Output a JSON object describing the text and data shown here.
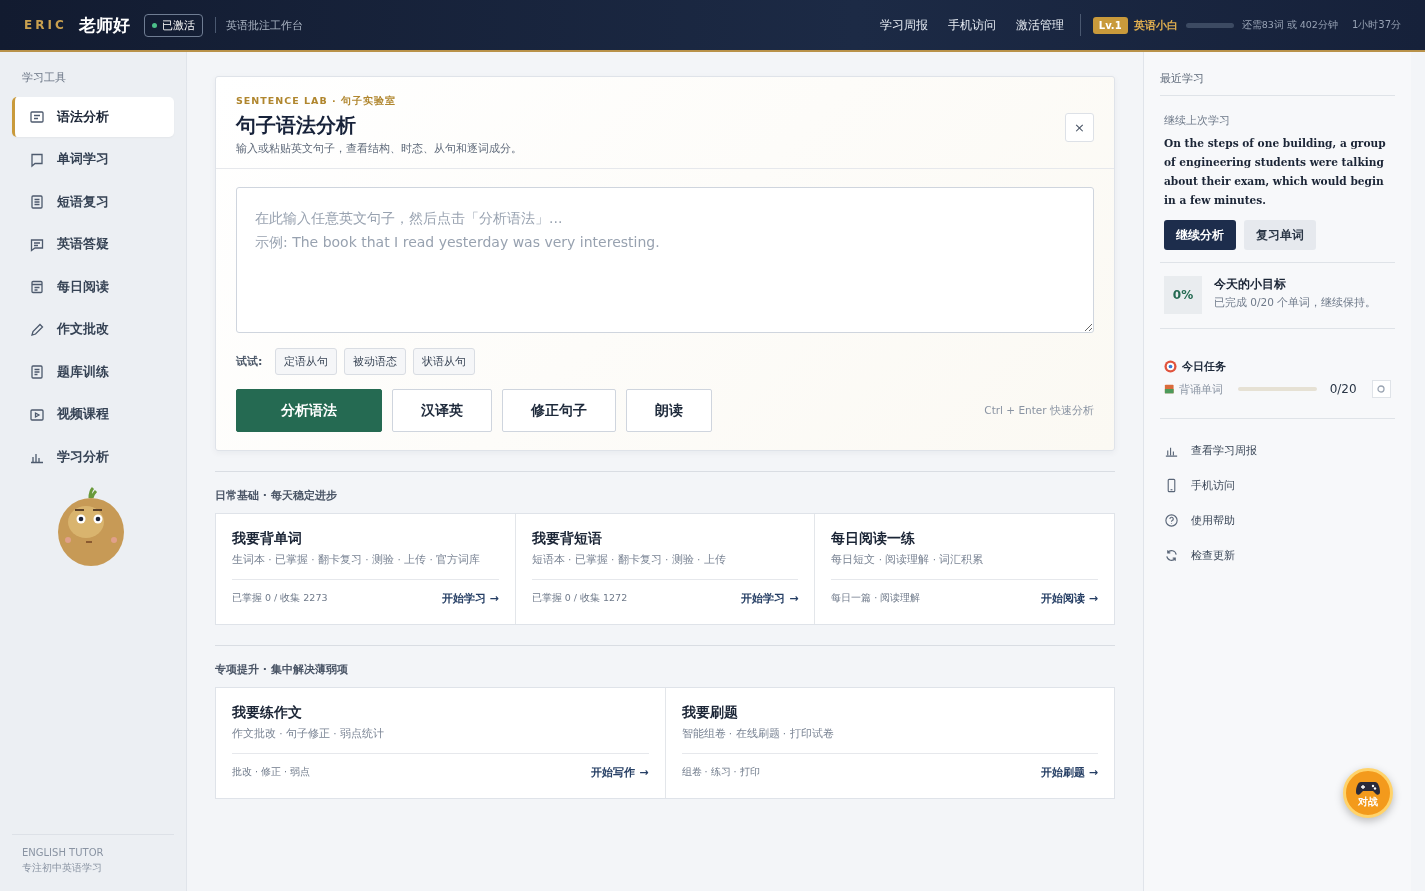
{
  "topbar": {
    "brand": "ERIC",
    "greeting": "老师好",
    "status": {
      "label": "已激活",
      "on": true
    },
    "subtitle": "英语批注工作台",
    "links": [
      "学习周报",
      "手机访问",
      "激活管理"
    ],
    "level": {
      "badge": "Lv.1",
      "title": "英语小白",
      "level": 0.0,
      "remaining": "还需83词 或 402分钟",
      "time": "1小时37分"
    }
  },
  "sidebar": {
    "heading": "学习工具",
    "items": [
      {
        "label": "语法分析",
        "selected": true
      },
      {
        "label": "单词学习",
        "selected": false
      },
      {
        "label": "短语复习",
        "selected": false
      },
      {
        "label": "英语答疑",
        "selected": false
      },
      {
        "label": "每日阅读",
        "selected": false
      },
      {
        "label": "作文批改",
        "selected": false
      },
      {
        "label": "题库训练",
        "selected": false
      },
      {
        "label": "视频课程",
        "selected": false
      },
      {
        "label": "学习分析",
        "selected": false
      }
    ],
    "footer": {
      "title": "ENGLISH TUTOR",
      "subtitle": "专注初中英语学习"
    }
  },
  "lab": {
    "eyebrow": "SENTENCE LAB · 句子实验室",
    "title": "句子语法分析",
    "subtitle": "输入或粘贴英文句子，查看结构、时态、从句和逐词成分。",
    "close": "×",
    "input": {
      "placeholder": "在此输入任意英文句子，然后点击「分析语法」...\n示例: The book that I read yesterday was very interesting."
    },
    "try_label": "试试:",
    "examples": [
      "定语从句",
      "被动语态",
      "状语从句"
    ],
    "actions": [
      {
        "label": "分析语法",
        "kind": "primary"
      },
      {
        "label": "汉译英",
        "kind": "secondary"
      },
      {
        "label": "修正句子",
        "kind": "secondary"
      },
      {
        "label": "朗读",
        "kind": "secondary"
      }
    ],
    "hint": "Ctrl + Enter 快速分析"
  },
  "sections": [
    {
      "title": "日常基础 · 每天稳定进步",
      "cards": [
        {
          "title": "我要背单词",
          "desc": "生词本 · 已掌握 · 翻卡复习 · 测验 · 上传 · 官方词库",
          "meta": "已掌握 0 / 收集 2273",
          "action": "开始学习 →"
        },
        {
          "title": "我要背短语",
          "desc": "短语本 · 已掌握 · 翻卡复习 · 测验 · 上传",
          "meta": "已掌握 0 / 收集 1272",
          "action": "开始学习 →"
        },
        {
          "title": "每日阅读一练",
          "desc": "每日短文 · 阅读理解 · 词汇积累",
          "meta": "每日一篇 · 阅读理解",
          "action": "开始阅读 →"
        }
      ]
    },
    {
      "title": "专项提升 · 集中解决薄弱项",
      "cards": [
        {
          "title": "我要练作文",
          "desc": "作文批改 · 句子修正 · 弱点统计",
          "meta": "批改 · 修正 · 弱点",
          "action": "开始写作 →"
        },
        {
          "title": "我要刷题",
          "desc": "智能组卷 · 在线刷题 · 打印试卷",
          "meta": "组卷 · 练习 · 打印",
          "action": "开始刷题 →"
        }
      ]
    }
  ],
  "right": {
    "heading": "最近学习",
    "resume": {
      "label": "继续上次学习",
      "sentence": "On the steps of one building, a group of engineering students were talking about their exam, which would begin in a few minutes.",
      "buttons": [
        {
          "label": "继续分析",
          "kind": "primary"
        },
        {
          "label": "复习单词",
          "kind": "secondary"
        }
      ]
    },
    "goal": {
      "percent": "0%",
      "title": "今天的小目标",
      "desc": "已完成 0/20 个单词，继续保持。"
    },
    "tasks": {
      "title": "今日任务",
      "items": [
        {
          "label": "背诵单词",
          "level": 0.0,
          "count": "0/20"
        }
      ]
    },
    "links": [
      "查看学习周报",
      "手机访问",
      "使用帮助",
      "检查更新"
    ]
  },
  "fab": {
    "label": "对战"
  }
}
